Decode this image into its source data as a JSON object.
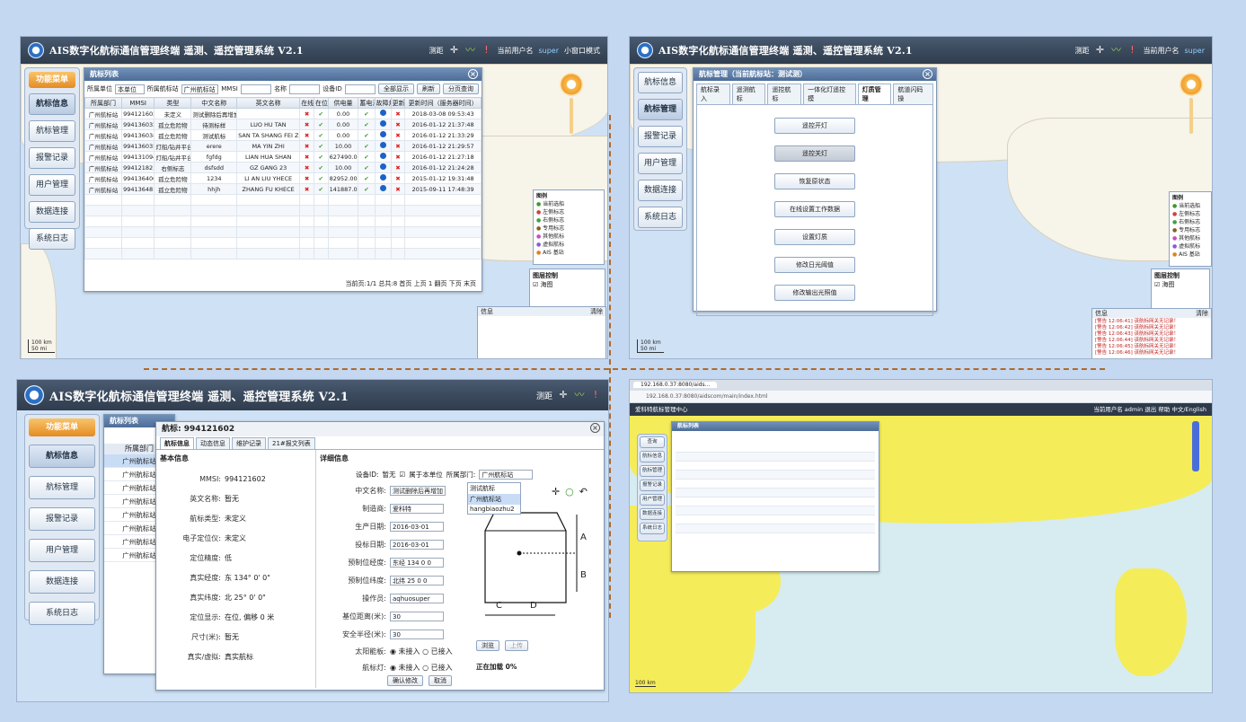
{
  "app_title": "AIS数字化航标通信管理终端 遥测、遥控管理系统 V2.1",
  "toolbar": {
    "measure": "测距",
    "user_label": "当前用户名",
    "user": "super",
    "minimap": "小窗口模式"
  },
  "sidebar": {
    "header": "功能菜单",
    "items": [
      "航标信息",
      "航标管理",
      "报警记录",
      "用户管理",
      "数据连接",
      "系统日志"
    ]
  },
  "p1": {
    "win_title": "航标列表",
    "filters": {
      "unit_label": "所属单位",
      "unit_value": "本单位",
      "station_label": "所属航标站",
      "station_value": "广州航标站",
      "mmsi_label": "MMSI",
      "name_label": "名称",
      "device_label": "设备ID"
    },
    "buttons": {
      "show_all": "全部显示",
      "refresh": "刷新",
      "paged": "分页查询"
    },
    "columns": [
      "所属部门",
      "MMSI",
      "类型",
      "中文名称",
      "英文名称",
      "在线",
      "在位",
      "供电量",
      "蓄电池",
      "故障灯",
      "更新",
      "更新时间（服务器时间）"
    ],
    "rows": [
      {
        "dept": "广州航标站",
        "mmsi": "994121602",
        "type": "未定义",
        "cn": "测试删除后再增加",
        "en": "",
        "v": "0.00",
        "time": "2018-03-08 09:53:43"
      },
      {
        "dept": "广州航标站",
        "mmsi": "994136032",
        "type": "孤立危险物",
        "cn": "待测标样",
        "en": "LUO HU TAN",
        "v": "0.00",
        "time": "2016-01-12 21:37:48"
      },
      {
        "dept": "广州航标站",
        "mmsi": "994136034",
        "type": "孤立危险物",
        "cn": "测试航标",
        "en": "SAN TA SHANG FEI ZH",
        "v": "0.00",
        "time": "2016-01-12 21:33:29"
      },
      {
        "dept": "广州航标站",
        "mmsi": "994136035",
        "type": "灯船/钻井平台",
        "cn": "erere",
        "en": "MA YIN ZHI",
        "v": "10.00",
        "time": "2016-01-12 21:29:57"
      },
      {
        "dept": "广州航标站",
        "mmsi": "994131094",
        "type": "灯船/钻井平台",
        "cn": "fgfdg",
        "en": "LIAN HUA SHAN",
        "v": "627490.00",
        "time": "2016-01-12 21:27:18"
      },
      {
        "dept": "广州航标站",
        "mmsi": "994121821",
        "type": "右侧标志",
        "cn": "dsfsdd",
        "en": "GZ GANG 23",
        "v": "10.00",
        "time": "2016-01-12 21:24:28"
      },
      {
        "dept": "广州航标站",
        "mmsi": "994136400",
        "type": "孤立危险物",
        "cn": "1234",
        "en": "LI AN LIU YHECE",
        "v": "82952.00",
        "time": "2015-01-12 19:31:48"
      },
      {
        "dept": "广州航标站",
        "mmsi": "994136481",
        "type": "孤立危险物",
        "cn": "hhjh",
        "en": "ZHANG FU KHECE",
        "v": "141887.00",
        "time": "2015-09-11 17:48:39"
      }
    ],
    "pager": "当前页:1/1 总共:8  首页  上页 1  翻页  下页  末页",
    "info_title": "信息",
    "info_clear": "清除",
    "legend_title": "图例",
    "legend_items": [
      "当前选船",
      "左侧标志",
      "右侧标志",
      "专用标志",
      "其他航标",
      "虚拟航标",
      "AIS 基站"
    ],
    "layer_title": "图层控制",
    "layer_item": "海图",
    "scale": [
      "100 km",
      "50 mi"
    ]
  },
  "p2": {
    "win_title": "航标管理（当前航标站：测试测）",
    "tabs": [
      "航标录入",
      "遥测航标",
      "遥控航标",
      "一体化灯遥控模",
      "灯质管理",
      "航道闪码操"
    ],
    "buttons": [
      "遥控开灯",
      "遥控关灯",
      "恢复原状态",
      "在线设置工作数据",
      "设置灯质",
      "修改日光阈值",
      "修改输出光照值"
    ],
    "info_title": "信息",
    "info_clear": "清除",
    "info_lines": [
      "[警告 12:06:41] 该航标网关无记录！",
      "[警告 12:06:42] 该航标网关无记录！",
      "[警告 12:06:43] 该航标网关无记录！",
      "[警告 12:06:44] 该航标网关无记录！",
      "[警告 12:06:45] 该航标网关无记录！",
      "[警告 12:06:46] 该航标网关无记录！"
    ],
    "legend_title": "图例",
    "layer_title": "图层控制",
    "layer_item": "海图",
    "scale": [
      "100 km",
      "50 mi"
    ]
  },
  "p3": {
    "list_title": "航标列表",
    "detail_title": "航标: 994121602",
    "tabs": [
      "航标信息",
      "动态信息",
      "维护记录",
      "21#报文列表"
    ],
    "basic_title": "基本信息",
    "basic": [
      {
        "k": "MMSI:",
        "v": "994121602"
      },
      {
        "k": "英文名称:",
        "v": "暂无"
      },
      {
        "k": "航标类型:",
        "v": "未定义"
      },
      {
        "k": "电子定位仪:",
        "v": "未定义"
      },
      {
        "k": "定位精度:",
        "v": "低"
      },
      {
        "k": "真实经度:",
        "v": "东 134° 0' 0\""
      },
      {
        "k": "真实纬度:",
        "v": "北 25° 0' 0\""
      },
      {
        "k": "定位显示:",
        "v": "在位, 偏移 0 米"
      },
      {
        "k": "尺寸(米):",
        "v": "暂无"
      },
      {
        "k": "真实/虚拟:",
        "v": "真实航标"
      }
    ],
    "detail_section": "详细信息",
    "device_label": "设备ID:",
    "device_value": "暂无",
    "own_unit": "属于本单位",
    "dept_label": "所属部门:",
    "dept_value": "广州航标站",
    "dept_options": [
      "测试航标",
      "广州航标站",
      "hangbiaozhu2"
    ],
    "fields": [
      {
        "k": "中文名称:",
        "v": "测试删除后再增加"
      },
      {
        "k": "制造商:",
        "v": "爱科特"
      },
      {
        "k": "生产日期:",
        "v": "2016-03-01"
      },
      {
        "k": "投标日期:",
        "v": "2016-03-01"
      },
      {
        "k": "预制位经度:",
        "v": "东经 134 0 0"
      },
      {
        "k": "预制位纬度:",
        "v": "北纬 25 0 0"
      },
      {
        "k": "操作员:",
        "v": "aqhuosuper"
      },
      {
        "k": "基位距离(米):",
        "v": "30"
      },
      {
        "k": "安全半径(米):",
        "v": "30"
      }
    ],
    "solar_label": "太阳能板:",
    "lamp_label": "航标灯:",
    "opt_no": "未接入",
    "opt_yes": "已接入",
    "confirm": "确认修改",
    "cancel": "取消",
    "browse": "浏览",
    "upload": "上传",
    "loading": "正在加载 0%",
    "list_col": "所属部门",
    "list_rows": [
      "广州航标站",
      "广州航标站",
      "广州航标站",
      "广州航标站",
      "广州航标站",
      "广州航标站",
      "广州航标站",
      "广州航标站"
    ],
    "dim_labels": [
      "A",
      "B",
      "C",
      "D"
    ]
  },
  "p4": {
    "browser_tab": "192.168.0.37:8080/aids...",
    "url": "192.168.0.37:8080/aidscom/main/index.html",
    "app_header": "爱科特航标管理中心",
    "user_info": "当前用户名 admin  退出  帮助  中文/English",
    "sidebar": [
      "查询",
      "航标信息",
      "航标管理",
      "报警记录",
      "用户管理",
      "数据连接",
      "系统日志"
    ],
    "win_title": "航标列表",
    "scale": "100 km"
  },
  "colors": {
    "accent": "#f0a030",
    "titlebar": "#3b4a5d",
    "sea": "#cfe1f4",
    "land": "#f7f4ea",
    "chart_land": "#f5ec5a",
    "divider": "#b06a2a"
  }
}
